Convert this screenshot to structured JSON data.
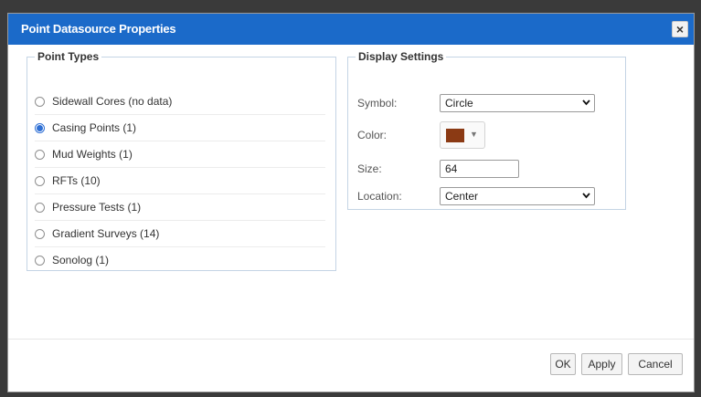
{
  "dialog": {
    "title": "Point Datasource Properties",
    "close_label": "×"
  },
  "point_types": {
    "legend": "Point Types",
    "items": [
      {
        "label": "Sidewall Cores (no data)",
        "checked": false
      },
      {
        "label": "Casing Points (1)",
        "checked": true
      },
      {
        "label": "Mud Weights (1)",
        "checked": false
      },
      {
        "label": "RFTs (10)",
        "checked": false
      },
      {
        "label": "Pressure Tests (1)",
        "checked": false
      },
      {
        "label": "Gradient Surveys (14)",
        "checked": false
      },
      {
        "label": "Sonolog (1)",
        "checked": false
      }
    ]
  },
  "display_settings": {
    "legend": "Display Settings",
    "symbol_label": "Symbol:",
    "symbol_value": "Circle",
    "color_label": "Color:",
    "color_value": "#8b3a14",
    "color_caret": "▼",
    "size_label": "Size:",
    "size_value": "64",
    "location_label": "Location:",
    "location_value": "Center"
  },
  "footer": {
    "ok_label": "OK",
    "apply_label": "Apply",
    "cancel_label": "Cancel"
  },
  "colors": {
    "titlebar": "#1b6ac9",
    "accent": "#2e6fd4"
  }
}
